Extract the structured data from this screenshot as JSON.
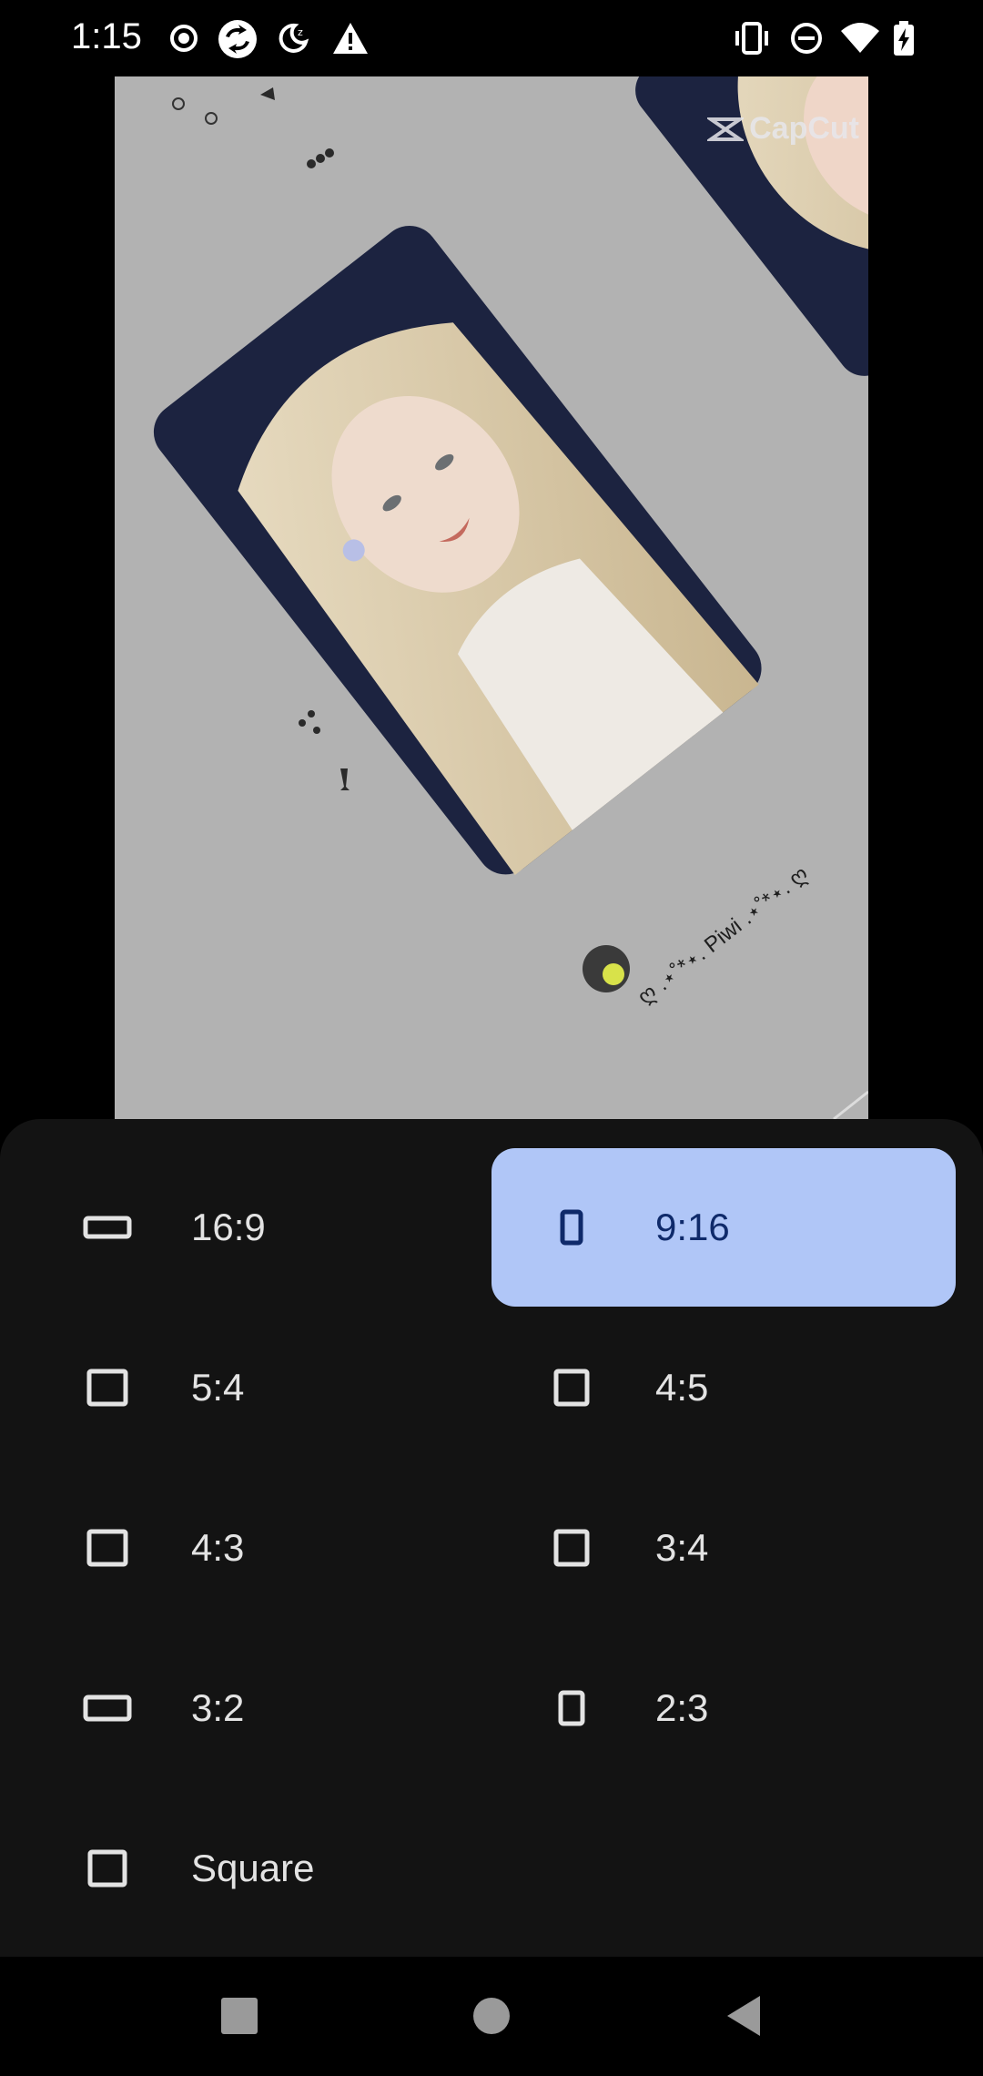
{
  "status_bar": {
    "time": "1:15",
    "left_icons": [
      "record-icon",
      "sync-icon",
      "do-not-disturb-moon-icon",
      "warning-icon"
    ],
    "right_icons": [
      "vibrate-icon",
      "dnd-icon",
      "wifi-icon",
      "battery-charging-icon"
    ]
  },
  "preview": {
    "watermark": "CapCut",
    "caption": "ღ .⋆˚*⋆. Piwi .⋆˚*⋆. ღ"
  },
  "aspect_options": [
    {
      "label": "16:9",
      "icon": "landscape-rect-icon",
      "selected": false
    },
    {
      "label": "9:16",
      "icon": "portrait-rect-icon",
      "selected": true
    },
    {
      "label": "5:4",
      "icon": "square-icon",
      "selected": false
    },
    {
      "label": "4:5",
      "icon": "portrait-square-icon",
      "selected": false
    },
    {
      "label": "4:3",
      "icon": "square-icon",
      "selected": false
    },
    {
      "label": "3:4",
      "icon": "portrait-square-icon",
      "selected": false
    },
    {
      "label": "3:2",
      "icon": "landscape-rect-icon",
      "selected": false
    },
    {
      "label": "2:3",
      "icon": "portrait-rect-icon",
      "selected": false
    },
    {
      "label": "Square",
      "icon": "square-icon",
      "selected": false
    }
  ],
  "colors": {
    "sheet_bg": "#131313",
    "selected_bg": "#b0c6f7",
    "selected_text": "#0f2a6a",
    "text": "#e3e3e3"
  },
  "navbar": {
    "buttons": [
      "recents-button",
      "home-button",
      "back-button"
    ]
  }
}
